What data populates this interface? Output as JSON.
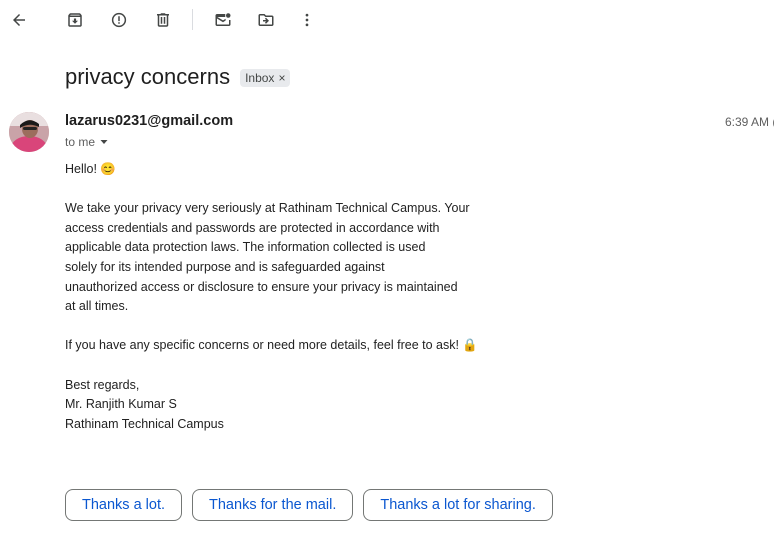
{
  "toolbar": {
    "icons": [
      "back-arrow-icon",
      "archive-icon",
      "report-spam-icon",
      "delete-icon",
      "mark-unread-icon",
      "move-to-icon",
      "more-vert-icon"
    ]
  },
  "subject": "privacy concerns",
  "label_chip": {
    "text": "Inbox",
    "remove": "×"
  },
  "sender": "lazarus0231@gmail.com",
  "recipient": "to me",
  "time": "6:39 AM (",
  "body": {
    "greeting": "Hello! 😊",
    "para1_lines": [
      "We take your privacy very seriously at Rathinam Technical Campus. Your",
      "access credentials and passwords are protected in accordance with",
      "applicable data protection laws. The information collected is used",
      "solely for its intended purpose and is safeguarded against",
      "unauthorized access or disclosure to ensure your privacy is maintained",
      "at all times."
    ],
    "para2": "If you have any specific concerns or need more details, feel free to ask! 🔒",
    "signoff": "Best regards,",
    "sig_name": "Mr. Ranjith Kumar S",
    "sig_org": "Rathinam Technical Campus"
  },
  "smart_replies": [
    "Thanks a lot.",
    "Thanks for the mail.",
    "Thanks a lot for sharing."
  ],
  "colors": {
    "link_blue": "#0b57d0",
    "chip_bg": "#e8eaed",
    "icon": "#444746"
  }
}
